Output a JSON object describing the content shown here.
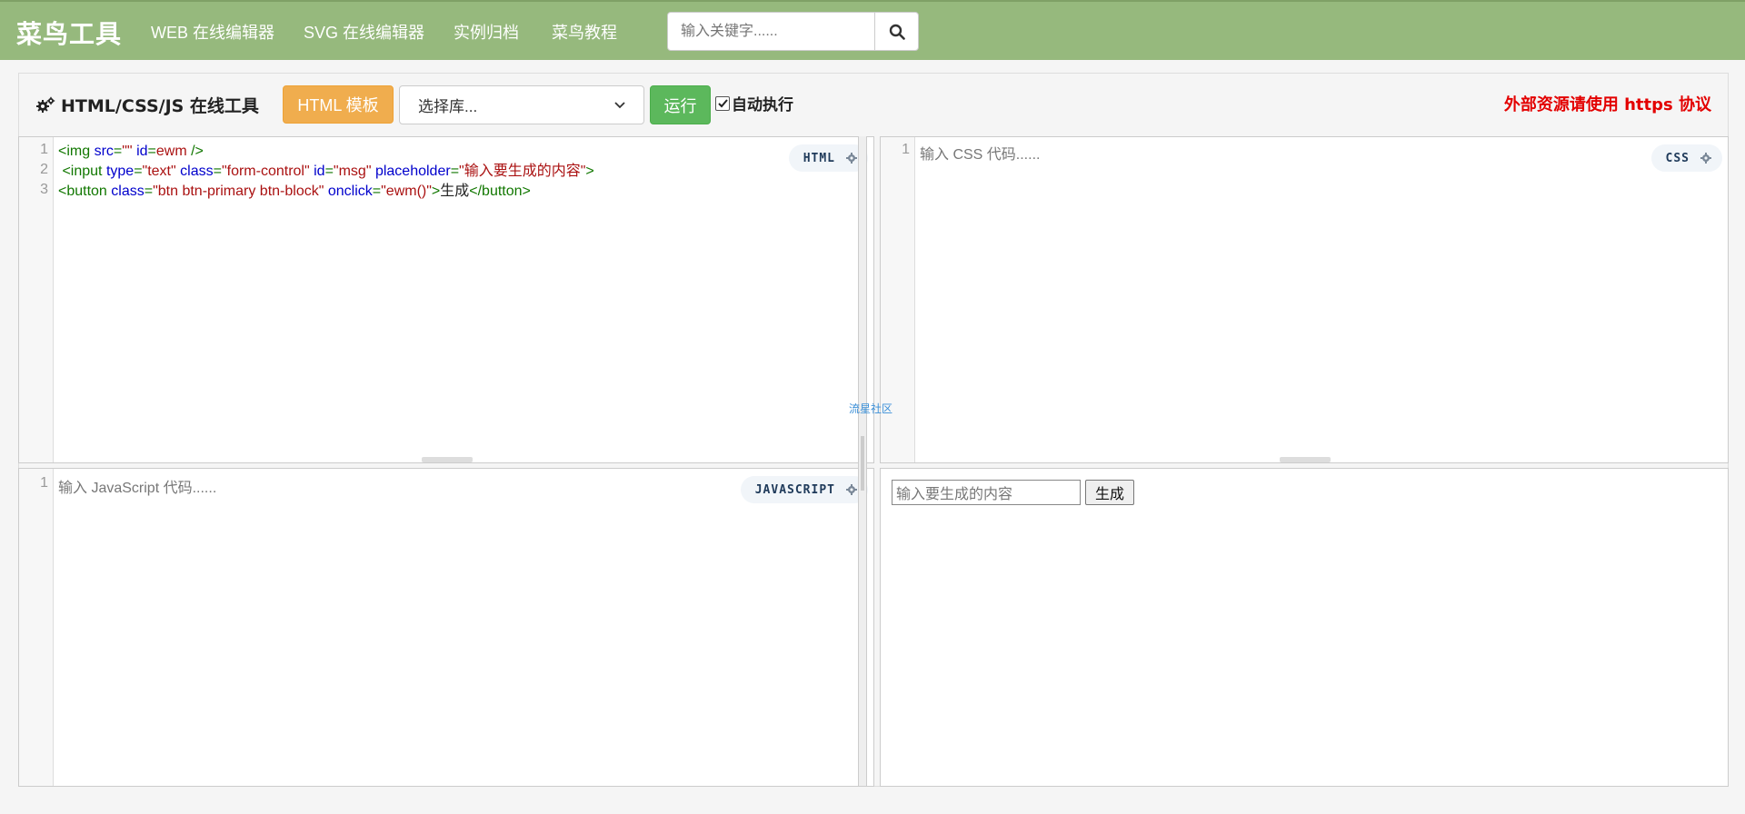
{
  "nav": {
    "brand": "菜鸟工具",
    "links": [
      "WEB 在线编辑器",
      "SVG 在线编辑器",
      "实例归档",
      "菜鸟教程"
    ],
    "search_placeholder": "输入关键字......"
  },
  "toolbar": {
    "title": "HTML/CSS/JS 在线工具",
    "template_button": "HTML 模板",
    "library_select": "选择库...",
    "run_button": "运行",
    "auto_run_label": "自动执行",
    "auto_run_checked": true,
    "https_note": "外部资源请使用 https 协议"
  },
  "html_editor": {
    "badge": "HTML",
    "line_numbers": [
      "1",
      "2",
      "3"
    ],
    "lines": [
      [
        {
          "cls": "tag",
          "t": "<img "
        },
        {
          "cls": "attr",
          "t": "src"
        },
        {
          "cls": "tag",
          "t": "="
        },
        {
          "cls": "str",
          "t": "\"\""
        },
        {
          "cls": "tag",
          "t": " "
        },
        {
          "cls": "attr",
          "t": "id"
        },
        {
          "cls": "tag",
          "t": "="
        },
        {
          "cls": "str",
          "t": "ewm"
        },
        {
          "cls": "tag",
          "t": " />"
        }
      ],
      [
        {
          "cls": "tag",
          "t": " <input "
        },
        {
          "cls": "attr",
          "t": "type"
        },
        {
          "cls": "tag",
          "t": "="
        },
        {
          "cls": "str",
          "t": "\"text\""
        },
        {
          "cls": "tag",
          "t": " "
        },
        {
          "cls": "attr",
          "t": "class"
        },
        {
          "cls": "tag",
          "t": "="
        },
        {
          "cls": "str",
          "t": "\"form-control\""
        },
        {
          "cls": "tag",
          "t": " "
        },
        {
          "cls": "attr",
          "t": "id"
        },
        {
          "cls": "tag",
          "t": "="
        },
        {
          "cls": "str",
          "t": "\"msg\""
        },
        {
          "cls": "tag",
          "t": " "
        },
        {
          "cls": "attr",
          "t": "placeholder"
        },
        {
          "cls": "tag",
          "t": "="
        },
        {
          "cls": "str",
          "t": "\"输入要生成的内容\""
        },
        {
          "cls": "tag",
          "t": ">"
        }
      ],
      [
        {
          "cls": "tag",
          "t": "<button "
        },
        {
          "cls": "attr",
          "t": "class"
        },
        {
          "cls": "tag",
          "t": "="
        },
        {
          "cls": "str",
          "t": "\"btn btn-primary btn-block\""
        },
        {
          "cls": "tag",
          "t": " "
        },
        {
          "cls": "attr",
          "t": "onclick"
        },
        {
          "cls": "tag",
          "t": "="
        },
        {
          "cls": "str",
          "t": "\"ewm()\""
        },
        {
          "cls": "tag",
          "t": ">"
        },
        {
          "cls": "txt",
          "t": "生成"
        },
        {
          "cls": "tag",
          "t": "</button>"
        }
      ]
    ]
  },
  "css_editor": {
    "badge": "CSS",
    "line_numbers": [
      "1"
    ],
    "placeholder": "输入 CSS 代码......"
  },
  "js_editor": {
    "badge": "JAVASCRIPT",
    "line_numbers": [
      "1"
    ],
    "placeholder": "输入 JavaScript 代码......"
  },
  "preview": {
    "input_placeholder": "输入要生成的内容",
    "button_label": "生成"
  },
  "watermark": "流星社区",
  "colors": {
    "navbar": "#96b97d",
    "template_button": "#f0ad4e",
    "run_button": "#5cb85c",
    "https_note": "#e30000"
  }
}
